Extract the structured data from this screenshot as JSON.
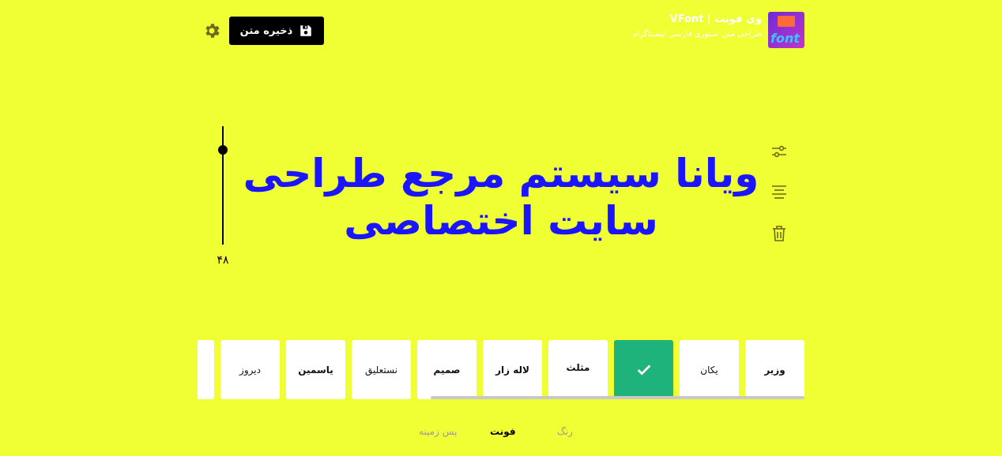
{
  "header": {
    "logo_text": "font",
    "title": "وی فونت | VFont",
    "subtitle": "طراحی متن استوری فارسی اینستاگرام",
    "save_label": "ذخیره متن"
  },
  "slider": {
    "value": "۴۸",
    "level": 0.8
  },
  "main_text": {
    "line1": "ویانا سیستم مرجع طراحی",
    "line2": "سایت اختصاصی"
  },
  "fonts": [
    {
      "label": "وزیر",
      "bold": true
    },
    {
      "label": "یکان",
      "bold": false
    },
    {
      "label": "",
      "selected": true
    },
    {
      "label": "مثلث",
      "bold": true
    },
    {
      "label": "لاله زار",
      "bold": true
    },
    {
      "label": "صمیم",
      "bold": true
    },
    {
      "label": "نستعلیق",
      "script": true
    },
    {
      "label": "یاسمین",
      "bold": true
    },
    {
      "label": "دیروز",
      "bold": false
    },
    {
      "label": "",
      "bold": false
    }
  ],
  "tabs": {
    "background": "پس زمینه",
    "font": "فونت",
    "color": "رنگ"
  },
  "colors": {
    "background": "#f0ff33",
    "text": "#1a14ff",
    "selected": "#1db37a"
  }
}
